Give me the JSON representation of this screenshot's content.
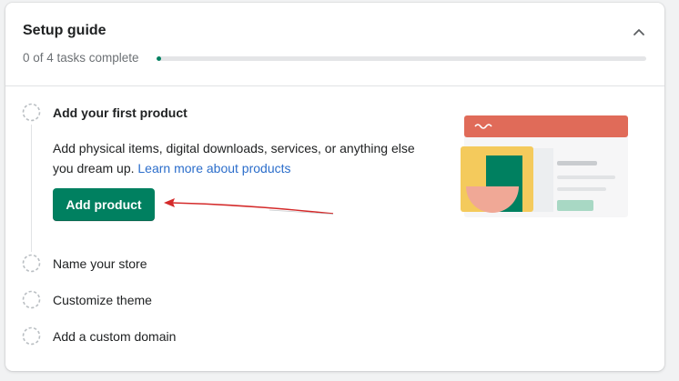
{
  "setup": {
    "title": "Setup guide",
    "progress_text": "0 of 4 tasks complete",
    "progress_fraction": 0.01
  },
  "steps": [
    {
      "label": "Add your first product"
    },
    {
      "label": "Name your store"
    },
    {
      "label": "Customize theme"
    },
    {
      "label": "Add a custom domain"
    }
  ],
  "active_step": {
    "description": "Add physical items, digital downloads, services, or anything else you dream up.",
    "link_text": "Learn more about products",
    "button_label": "Add product"
  },
  "icons": {
    "collapse": "chevron-up-icon",
    "step_status": "dashed-circle-icon"
  },
  "colors": {
    "primary": "#008060",
    "link": "#2c6ecb",
    "annotation_arrow": "#d42a2a",
    "illustration_header": "#e06b59",
    "illustration_yellow": "#f4ca5c"
  }
}
